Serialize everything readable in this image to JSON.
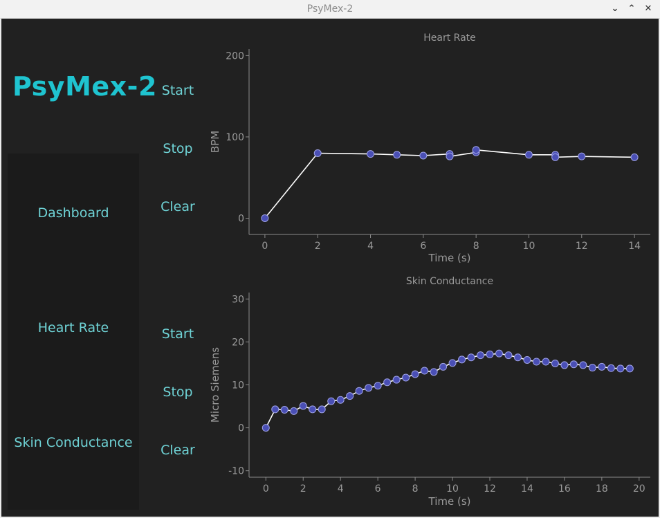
{
  "window": {
    "title": "PsyMex-2"
  },
  "brand": "PsyMex-2",
  "nav": {
    "items": [
      {
        "label": "Dashboard"
      },
      {
        "label": "Heart Rate"
      },
      {
        "label": "Skin Conductance"
      }
    ]
  },
  "controls": {
    "hr": {
      "start": "Start",
      "stop": "Stop",
      "clear": "Clear"
    },
    "sc": {
      "start": "Start",
      "stop": "Stop",
      "clear": "Clear"
    }
  },
  "colors": {
    "background": "#212121",
    "accent": "#1fc4d0",
    "marker": "#4a4fb5",
    "line": "#ffffff"
  },
  "chart_data": [
    {
      "type": "line",
      "title": "Heart Rate",
      "xlabel": "Time (s)",
      "ylabel": "BPM",
      "xlim": [
        -0.6,
        14.6
      ],
      "ylim": [
        -20,
        208
      ],
      "xticks": [
        0,
        2,
        4,
        6,
        8,
        10,
        12,
        14
      ],
      "yticks": [
        0,
        100,
        200
      ],
      "grid": false,
      "series": [
        {
          "x": [
            0,
            2,
            4,
            5,
            6,
            7,
            7,
            8,
            8,
            10,
            11,
            11,
            12,
            14
          ],
          "y": [
            0,
            80,
            79,
            78,
            77,
            79,
            76,
            81,
            84,
            78,
            78,
            75,
            76,
            75
          ]
        }
      ]
    },
    {
      "type": "line",
      "title": "Skin Conductance",
      "xlabel": "Time (s)",
      "ylabel": "Micro Siemens",
      "xlim": [
        -0.9,
        20.6
      ],
      "ylim": [
        -11.5,
        31.5
      ],
      "xticks": [
        0,
        2,
        4,
        6,
        8,
        10,
        12,
        14,
        16,
        18,
        20
      ],
      "yticks": [
        -10,
        0,
        10,
        20,
        30
      ],
      "grid": false,
      "series": [
        {
          "x": [
            0,
            0.5,
            1.0,
            1.5,
            2.0,
            2.5,
            3.0,
            3.5,
            4.0,
            4.5,
            5.0,
            5.5,
            6.0,
            6.5,
            7.0,
            7.5,
            8.0,
            8.5,
            9.0,
            9.5,
            10.0,
            10.5,
            11.0,
            11.5,
            12.0,
            12.5,
            13.0,
            13.5,
            14.0,
            14.5,
            15.0,
            15.5,
            16.0,
            16.5,
            17.0,
            17.5,
            18.0,
            18.5,
            19.0,
            19.5
          ],
          "y": [
            0,
            4.3,
            4.2,
            3.9,
            5.1,
            4.3,
            4.3,
            6.2,
            6.5,
            7.4,
            8.6,
            9.3,
            9.8,
            10.6,
            11.2,
            11.7,
            12.5,
            13.3,
            13.0,
            14.2,
            15.1,
            15.9,
            16.4,
            16.9,
            17.1,
            17.3,
            16.9,
            16.4,
            15.8,
            15.4,
            15.4,
            15.0,
            14.6,
            14.8,
            14.6,
            14.0,
            14.2,
            13.9,
            13.8,
            13.8
          ]
        }
      ]
    }
  ]
}
